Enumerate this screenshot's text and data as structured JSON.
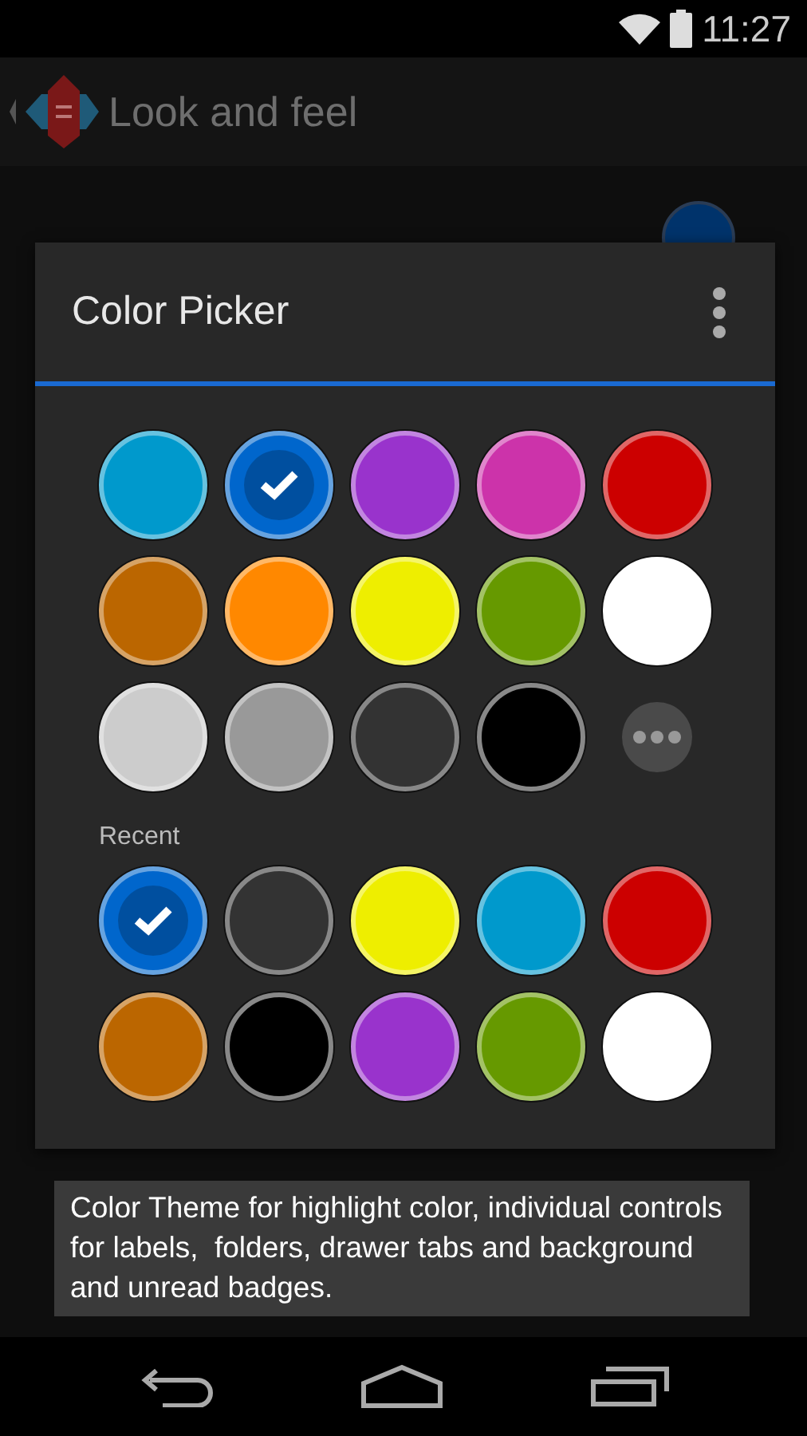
{
  "status_bar": {
    "time": "11:27"
  },
  "action_bar": {
    "title": "Look and feel"
  },
  "setting": {
    "color": "#00336b"
  },
  "dialog": {
    "title": "Color Picker",
    "palette": [
      {
        "color": "#0099cc",
        "selected": false
      },
      {
        "color": "#0066cc",
        "selected": true
      },
      {
        "color": "#9933cc",
        "selected": false
      },
      {
        "color": "#cc33aa",
        "selected": false
      },
      {
        "color": "#cc0000",
        "selected": false
      },
      {
        "color": "#bb6600",
        "selected": false
      },
      {
        "color": "#ff8800",
        "selected": false
      },
      {
        "color": "#eeee00",
        "selected": false
      },
      {
        "color": "#669900",
        "selected": false
      },
      {
        "color": "#ffffff",
        "selected": false
      },
      {
        "color": "#cccccc",
        "selected": false
      },
      {
        "color": "#999999",
        "selected": false
      },
      {
        "color": "#333333",
        "selected": false
      },
      {
        "color": "#000000",
        "selected": false
      }
    ],
    "recent_label": "Recent",
    "recent": [
      {
        "color": "#0066cc",
        "selected": true
      },
      {
        "color": "#333333",
        "selected": false
      },
      {
        "color": "#eeee00",
        "selected": false
      },
      {
        "color": "#0099cc",
        "selected": false
      },
      {
        "color": "#cc0000",
        "selected": false
      },
      {
        "color": "#bb6600",
        "selected": false
      },
      {
        "color": "#000000",
        "selected": false
      },
      {
        "color": "#9933cc",
        "selected": false
      },
      {
        "color": "#669900",
        "selected": false
      },
      {
        "color": "#ffffff",
        "selected": false
      }
    ]
  },
  "toast": "Color Theme for highlight color, individual controls for labels,  folders, drawer tabs and background and unread badges."
}
